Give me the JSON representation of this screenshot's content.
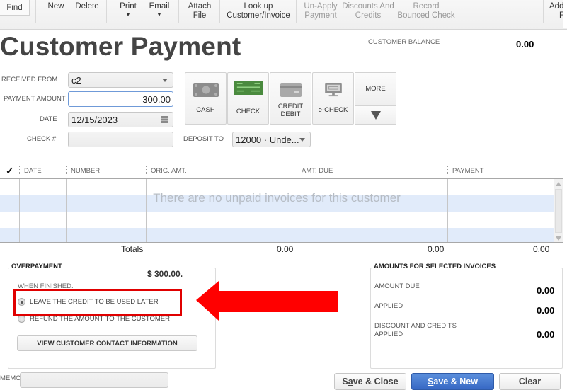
{
  "toolbar": {
    "find": "Find",
    "new": "New",
    "delete": "Delete",
    "print": "Print",
    "email": "Email",
    "attach_file_line1": "Attach",
    "attach_file_line2": "File",
    "lookup_line1": "Look up",
    "lookup_line2": "Customer/Invoice",
    "unapply_line1": "Un-Apply",
    "unapply_line2": "Payment",
    "discounts_line1": "Discounts And",
    "discounts_line2": "Credits",
    "record_line1": "Record",
    "record_line2": "Bounced Check",
    "add_partial_line1": "Add",
    "add_partial_line2": "F"
  },
  "header": {
    "title": "Customer Payment",
    "customer_balance_label": "CUSTOMER BALANCE",
    "customer_balance_value": "0.00"
  },
  "form": {
    "received_from_label": "RECEIVED FROM",
    "received_from_value": "c2",
    "payment_amount_label": "PAYMENT AMOUNT",
    "payment_amount_value": "300.00",
    "date_label": "DATE",
    "date_value": "12/15/2023",
    "check_no_label": "CHECK #",
    "check_no_value": "",
    "deposit_to_label": "DEPOSIT TO",
    "deposit_to_value": "12000 · Unde..."
  },
  "payment_methods": [
    {
      "label": "CASH",
      "icon": "cash-icon",
      "selected": false
    },
    {
      "label": "CHECK",
      "icon": "check-icon",
      "selected": true
    },
    {
      "label_line1": "CREDIT",
      "label_line2": "DEBIT",
      "icon": "credit-card-icon",
      "selected": false
    },
    {
      "label": "e-CHECK",
      "icon": "monitor-icon",
      "selected": false
    }
  ],
  "more_label": "MORE",
  "grid": {
    "columns": [
      "✓",
      "DATE",
      "NUMBER",
      "ORIG. AMT.",
      "AMT. DUE",
      "PAYMENT"
    ],
    "rows": [],
    "empty_message": "There are no unpaid invoices for this customer",
    "totals_label": "Totals",
    "totals": {
      "orig_amt": "0.00",
      "amt_due": "0.00",
      "payment": "0.00"
    }
  },
  "overpayment": {
    "title": "OVERPAYMENT",
    "amount": "$ 300.00.",
    "when_finished": "WHEN FINISHED:",
    "options": [
      {
        "label": "LEAVE THE CREDIT TO BE USED LATER",
        "checked": true
      },
      {
        "label": "REFUND THE AMOUNT TO THE CUSTOMER",
        "checked": false
      }
    ],
    "view_contact_button": "VIEW CUSTOMER CONTACT INFORMATION"
  },
  "memo": {
    "label": "MEMO",
    "value": ""
  },
  "amounts": {
    "title": "AMOUNTS FOR SELECTED INVOICES",
    "amount_due_label": "AMOUNT DUE",
    "amount_due_value": "0.00",
    "applied_label": "APPLIED",
    "applied_value": "0.00",
    "discount_label_line1": "DISCOUNT AND CREDITS",
    "discount_label_line2": "APPLIED",
    "discount_value": "0.00"
  },
  "buttons": {
    "save_close_pre": "S",
    "save_close_ul": "a",
    "save_close_post": "ve & Close",
    "save_new_ul": "S",
    "save_new_post": "ave & New",
    "clear": "Clear"
  },
  "annotation": {
    "color": "#ff0000"
  }
}
